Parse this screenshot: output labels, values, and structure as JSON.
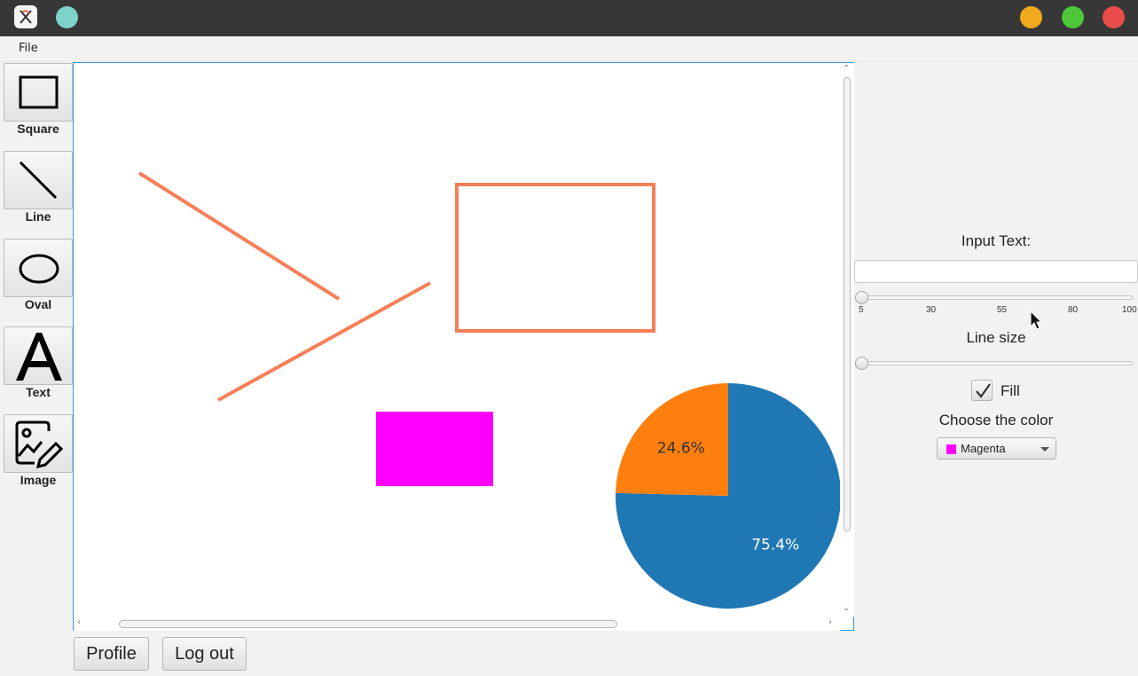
{
  "window": {
    "accent_dot_color": "#7dd3c9",
    "controls": [
      "minimize",
      "maximize",
      "close"
    ]
  },
  "menu": {
    "file_label": "File"
  },
  "tools": [
    {
      "label": "Square",
      "icon": "square-icon"
    },
    {
      "label": "Line",
      "icon": "line-icon"
    },
    {
      "label": "Oval",
      "icon": "oval-icon"
    },
    {
      "label": "Text",
      "icon": "text-icon"
    },
    {
      "label": "Image",
      "icon": "image-edit-icon"
    }
  ],
  "canvas": {
    "shape_stroke_color": "#f77f58",
    "fill_rect_color": "#ff00ff",
    "pie": {
      "slices": [
        {
          "label": "75.4%",
          "value": 75.4,
          "color": "#1f77b4"
        },
        {
          "label": "24.6%",
          "value": 24.6,
          "color": "#ff7f0e"
        }
      ]
    }
  },
  "panel": {
    "input_text_label": "Input Text:",
    "input_text_value": "",
    "text_size_slider": {
      "min": 5,
      "max": 100,
      "value": 5,
      "ticks": [
        "5",
        "30",
        "55",
        "80",
        "100"
      ]
    },
    "line_size_label": "Line size",
    "line_size_slider": {
      "value": 0
    },
    "fill_label": "Fill",
    "fill_checked": true,
    "choose_color_label": "Choose the color",
    "color_selected": "Magenta",
    "color_selected_hex": "#ff00ff"
  },
  "buttons": {
    "profile": "Profile",
    "logout": "Log out"
  }
}
